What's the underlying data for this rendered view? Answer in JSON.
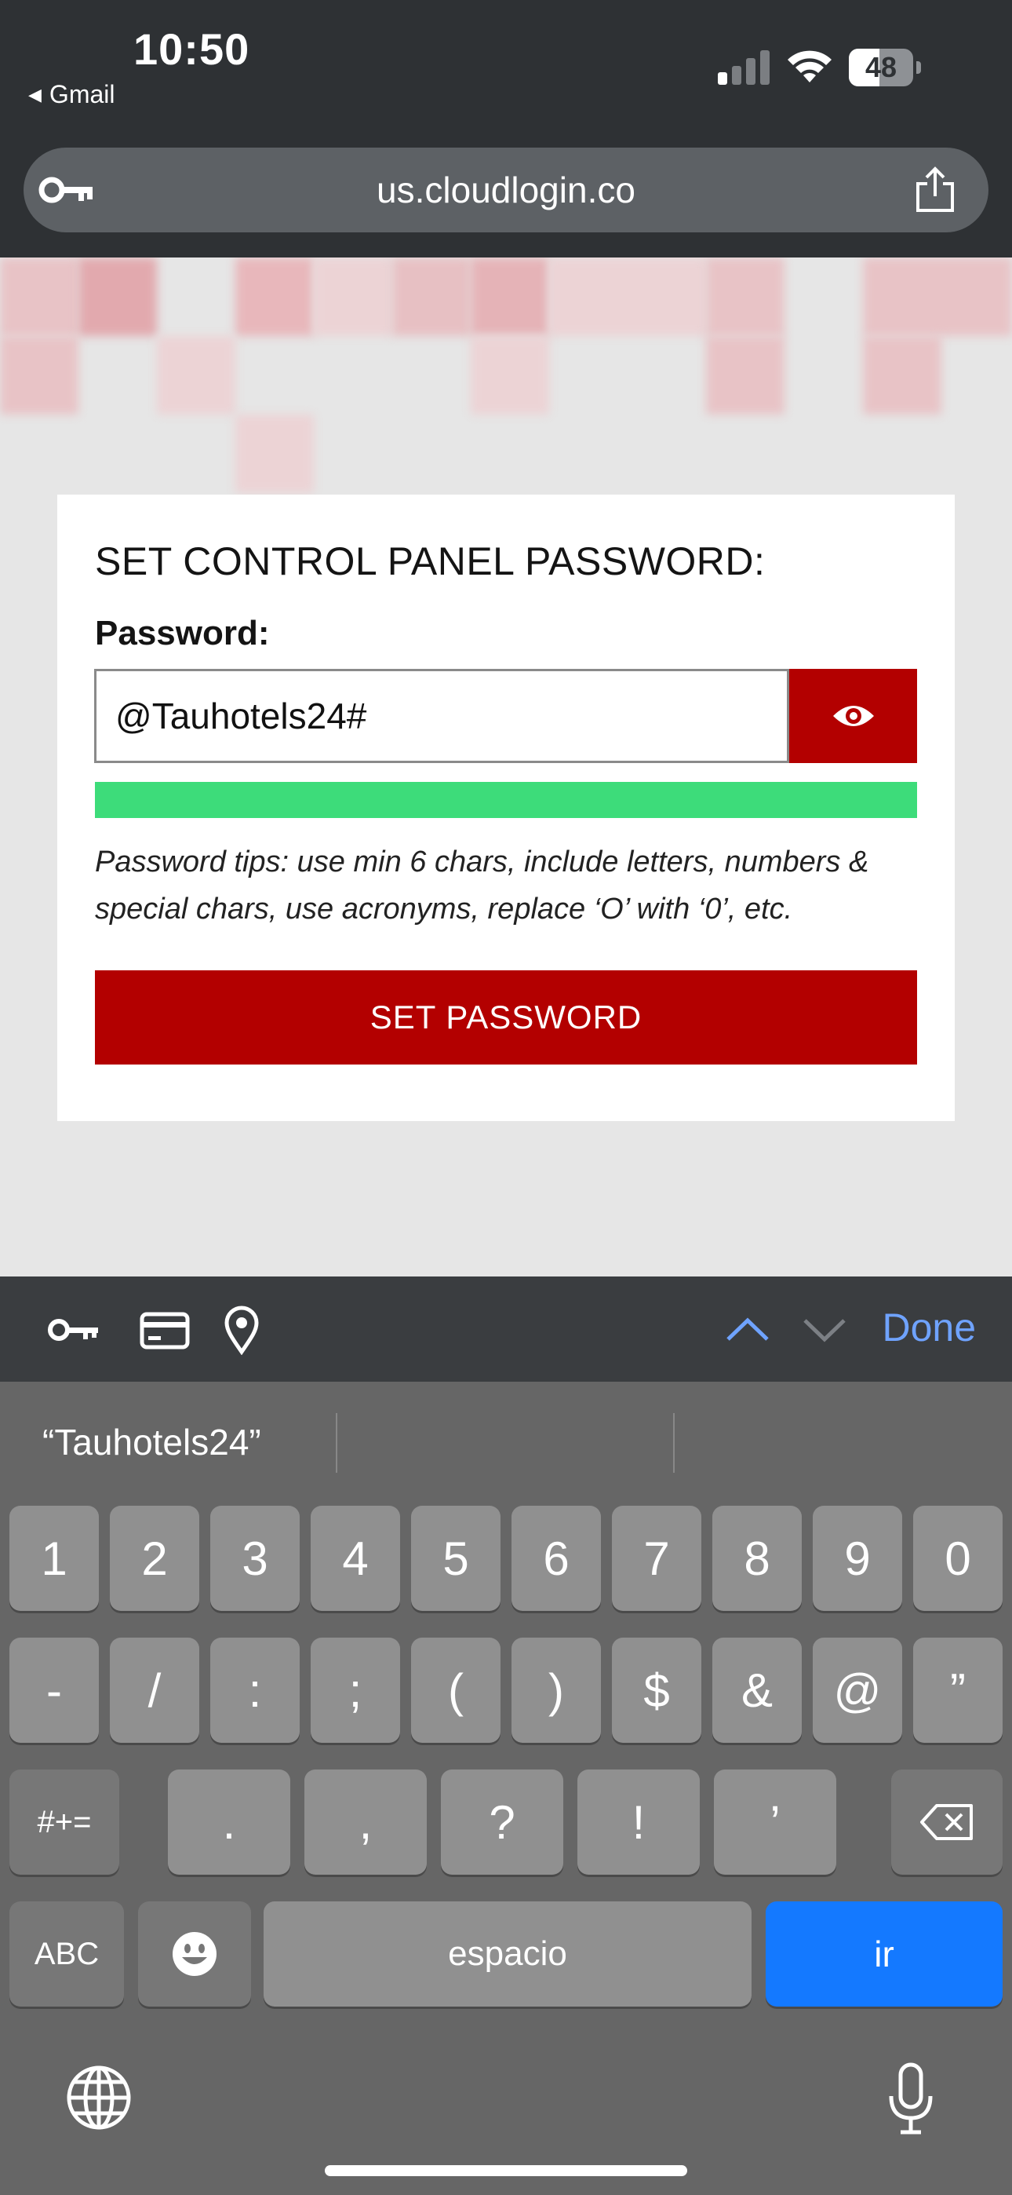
{
  "status_bar": {
    "time": "10:50",
    "back_app": "Gmail",
    "battery": "48",
    "battery_level": 0.48,
    "signal_bars_active": 1
  },
  "url_bar": {
    "url": "us.cloudlogin.co",
    "icons": [
      "key-icon",
      "share-icon"
    ]
  },
  "page": {
    "title": "SET CONTROL PANEL PASSWORD:",
    "password_label": "Password:",
    "password_value": "@Tauhotels24#",
    "strength_level": 1.0,
    "strength_color": "#3ddc7a",
    "tips": "Password tips: use min 6 chars, include letters, numbers & special chars, use acronyms, replace ‘O’ with ‘0’, etc.",
    "submit_label": "SET PASSWORD",
    "accent_color": "#b30000"
  },
  "accessory_bar": {
    "icons": [
      "key-icon",
      "credit-card-icon",
      "location-pin-icon",
      "chevron-up-icon",
      "chevron-down-icon"
    ],
    "done_label": "Done"
  },
  "keyboard": {
    "suggestion": "“Tauhotels24”",
    "row1": [
      "1",
      "2",
      "3",
      "4",
      "5",
      "6",
      "7",
      "8",
      "9",
      "0"
    ],
    "row2": [
      "-",
      "/",
      ":",
      ";",
      "(",
      ")",
      "$",
      "&",
      "@",
      "”"
    ],
    "row3": {
      "shift": "#+=",
      "keys": [
        ".",
        ",",
        "?",
        "!",
        "’"
      ],
      "delete_icon": "backspace-icon"
    },
    "row4": {
      "abc": "ABC",
      "emoji_icon": "emoji-icon",
      "space": "espacio",
      "go": "ir"
    },
    "bottom_icons": [
      "globe-icon",
      "microphone-icon"
    ]
  }
}
